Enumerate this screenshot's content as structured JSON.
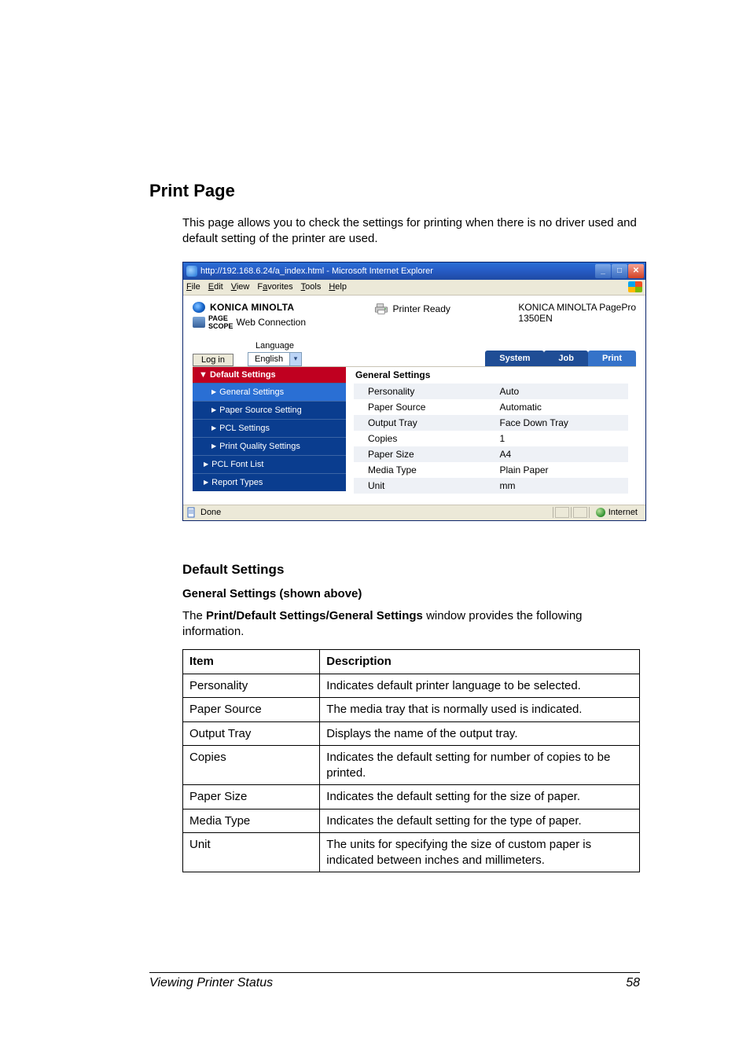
{
  "heading": "Print Page",
  "intro": "This page allows you to check the settings for printing when there is no driver used and default setting of the printer are used.",
  "ie": {
    "title": "http://192.168.6.24/a_index.html - Microsoft Internet Explorer",
    "menus": {
      "file": "File",
      "edit": "Edit",
      "view": "View",
      "favorites": "Favorites",
      "tools": "Tools",
      "help": "Help"
    },
    "status_done": "Done",
    "status_zone": "Internet"
  },
  "brand": {
    "company": "KONICA MINOLTA",
    "product": "PageScope Web Connection",
    "status": "Printer Ready",
    "model_line1": "KONICA MINOLTA PagePro",
    "model_line2": "1350EN"
  },
  "controls": {
    "login": "Log in",
    "language_label": "Language",
    "language_value": "English"
  },
  "tabs": {
    "system": "System",
    "job": "Job",
    "print": "Print"
  },
  "nav": {
    "header": "▼ Default Settings",
    "items": {
      "general": "General Settings",
      "paper_source": "Paper Source Setting",
      "pcl_settings": "PCL Settings",
      "print_quality": "Print Quality Settings",
      "pcl_font_list": "PCL Font List",
      "report_types": "Report Types"
    }
  },
  "pane": {
    "title": "General Settings",
    "rows": {
      "personality": {
        "k": "Personality",
        "v": "Auto"
      },
      "paper_source": {
        "k": "Paper Source",
        "v": "Automatic"
      },
      "output_tray": {
        "k": "Output Tray",
        "v": "Face Down Tray"
      },
      "copies": {
        "k": "Copies",
        "v": "1"
      },
      "paper_size": {
        "k": "Paper Size",
        "v": "A4"
      },
      "media_type": {
        "k": "Media Type",
        "v": "Plain Paper"
      },
      "unit": {
        "k": "Unit",
        "v": "mm"
      }
    }
  },
  "section2": {
    "h2": "Default Settings",
    "h3": "General Settings (shown above)",
    "lead_pre": "The ",
    "lead_bold": "Print/Default Settings/General Settings",
    "lead_post": " window provides the following information."
  },
  "doc_table": {
    "h_item": "Item",
    "h_desc": "Description",
    "rows": {
      "personality": {
        "item": "Personality",
        "desc": "Indicates default printer language to be selected."
      },
      "paper_source": {
        "item": "Paper Source",
        "desc": "The media tray that is normally used is indicated."
      },
      "output_tray": {
        "item": "Output Tray",
        "desc": "Displays the name of the output tray."
      },
      "copies": {
        "item": "Copies",
        "desc": "Indicates the default setting for number of copies to be printed."
      },
      "paper_size": {
        "item": "Paper Size",
        "desc": "Indicates the default setting for the size of paper."
      },
      "media_type": {
        "item": "Media Type",
        "desc": "Indicates the default setting for the type of paper."
      },
      "unit": {
        "item": "Unit",
        "desc": "The units for specifying the size of custom paper is indicated between inches and millimeters."
      }
    }
  },
  "footer": {
    "left": "Viewing Printer Status",
    "right": "58"
  }
}
